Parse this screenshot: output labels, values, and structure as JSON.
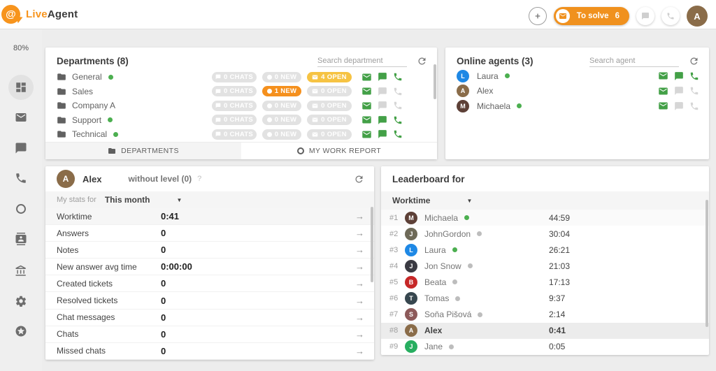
{
  "colors": {
    "brand_orange": "#f7941d",
    "accent_orange": "#f0911e",
    "chip_orange": "#f5901d",
    "chip_yellow": "#f6c343",
    "online_green": "#4caf50",
    "icon_green": "#43a047"
  },
  "header": {
    "logo_at": "@",
    "logo_live": "Live",
    "logo_agent": "Agent",
    "to_solve_label": "To solve",
    "to_solve_count": "6",
    "avatar_initial": "A",
    "avatar_color": "#8a6c49"
  },
  "sidebar": {
    "percent": "80%"
  },
  "departments": {
    "title": "Departments (8)",
    "search_placeholder": "Search department",
    "rows": [
      {
        "name": "General",
        "chats": "0 CHATS",
        "new": "0 NEW",
        "open": "4 OPEN"
      },
      {
        "name": "Sales",
        "chats": "0 CHATS",
        "new": "1 NEW",
        "open": "0 OPEN"
      },
      {
        "name": "Company A",
        "chats": "0 CHATS",
        "new": "0 NEW",
        "open": "0 OPEN"
      },
      {
        "name": "Support",
        "chats": "0 CHATS",
        "new": "0 NEW",
        "open": "0 OPEN"
      },
      {
        "name": "Technical",
        "chats": "0 CHATS",
        "new": "0 NEW",
        "open": "0 OPEN"
      }
    ],
    "tabs": {
      "departments": "DEPARTMENTS",
      "my_work_report": "MY WORK REPORT"
    }
  },
  "online_agents": {
    "title": "Online agents (3)",
    "search_placeholder": "Search agent",
    "rows": [
      {
        "name": "Laura",
        "initial": "L",
        "color": "#1e88e5"
      },
      {
        "name": "Alex",
        "initial": "A",
        "color": "#8a6c49"
      },
      {
        "name": "Michaela",
        "initial": "M",
        "color": "#5d4037"
      }
    ]
  },
  "my_stats": {
    "agent_name": "Alex",
    "agent_initial": "A",
    "agent_color": "#8a6c49",
    "level_label": "without level (0)",
    "help": "?",
    "stats_for_label": "My stats for",
    "period": "This month",
    "rows": [
      {
        "label": "Worktime",
        "value": "0:41"
      },
      {
        "label": "Answers",
        "value": "0"
      },
      {
        "label": "Notes",
        "value": "0"
      },
      {
        "label": "New answer avg time",
        "value": "0:00:00"
      },
      {
        "label": "Created tickets",
        "value": "0"
      },
      {
        "label": "Resolved tickets",
        "value": "0"
      },
      {
        "label": "Chat messages",
        "value": "0"
      },
      {
        "label": "Chats",
        "value": "0"
      },
      {
        "label": "Missed chats",
        "value": "0"
      }
    ]
  },
  "leaderboard": {
    "title": "Leaderboard for",
    "metric": "Worktime",
    "rows": [
      {
        "rank": "#1",
        "name": "Michaela",
        "initial": "M",
        "color": "#5d4037",
        "value": "44:59"
      },
      {
        "rank": "#2",
        "name": "JohnGordon",
        "initial": "J",
        "color": "#6e6a58",
        "value": "30:04"
      },
      {
        "rank": "#3",
        "name": "Laura",
        "initial": "L",
        "color": "#1e88e5",
        "value": "26:21"
      },
      {
        "rank": "#4",
        "name": "Jon Snow",
        "initial": "J",
        "color": "#3a3a42",
        "value": "21:03"
      },
      {
        "rank": "#5",
        "name": "Beata",
        "initial": "B",
        "color": "#c62828",
        "value": "17:13"
      },
      {
        "rank": "#6",
        "name": "Tomas",
        "initial": "T",
        "color": "#37474f",
        "value": "9:37"
      },
      {
        "rank": "#7",
        "name": "Soňa Pišová",
        "initial": "S",
        "color": "#8d5a5a",
        "value": "2:14"
      },
      {
        "rank": "#8",
        "name": "Alex",
        "initial": "A",
        "color": "#8a6c49",
        "value": "0:41"
      },
      {
        "rank": "#9",
        "name": "Jane",
        "initial": "J",
        "color": "#27ae60",
        "value": "0:05"
      }
    ]
  }
}
